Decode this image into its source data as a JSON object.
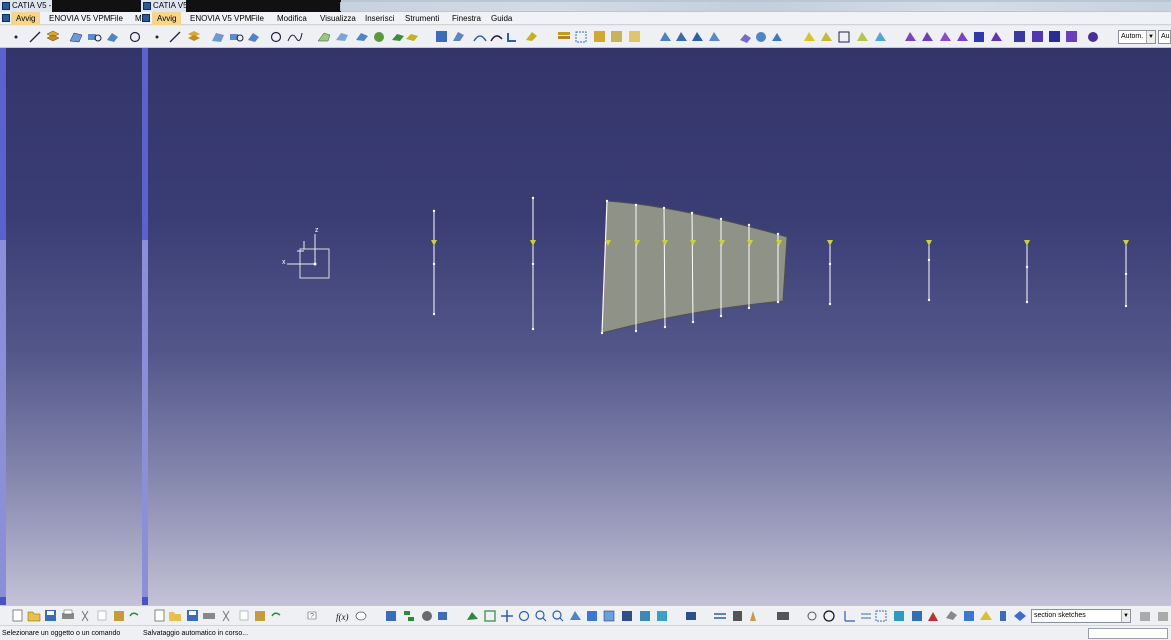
{
  "windows": [
    {
      "title": "CATIA V5 -"
    },
    {
      "title": "CATIA V5"
    }
  ],
  "menubar_left": [
    {
      "label": "Avvig",
      "highlight": true
    },
    {
      "label": "ENOVIA V5 VPM"
    },
    {
      "label": "File"
    },
    {
      "label": "M"
    }
  ],
  "menubar": [
    {
      "label": "Avvig",
      "highlight": true
    },
    {
      "label": "ENOVIA V5 VPM"
    },
    {
      "label": "File"
    },
    {
      "label": "Modifica"
    },
    {
      "label": "Visualizza"
    },
    {
      "label": "Inserisci"
    },
    {
      "label": "Strumenti"
    },
    {
      "label": "Finestra"
    },
    {
      "label": "Guida"
    }
  ],
  "toolbar": {
    "style_select": "Autom.",
    "style_select2": "Au"
  },
  "axis": {
    "z": "z",
    "x": "x"
  },
  "bottombar": {
    "select_value": "section sketches"
  },
  "status": {
    "prompt": "Selezionare un oggetto o un comando",
    "autosave": "Salvataggio automatico in corso..."
  },
  "colors": {
    "accent_menu": "#f7d58a",
    "background_top": "#33356a",
    "background_bottom": "#c3c2d6",
    "surface": "#8f9287",
    "highlight_green": "#c8d23a"
  }
}
